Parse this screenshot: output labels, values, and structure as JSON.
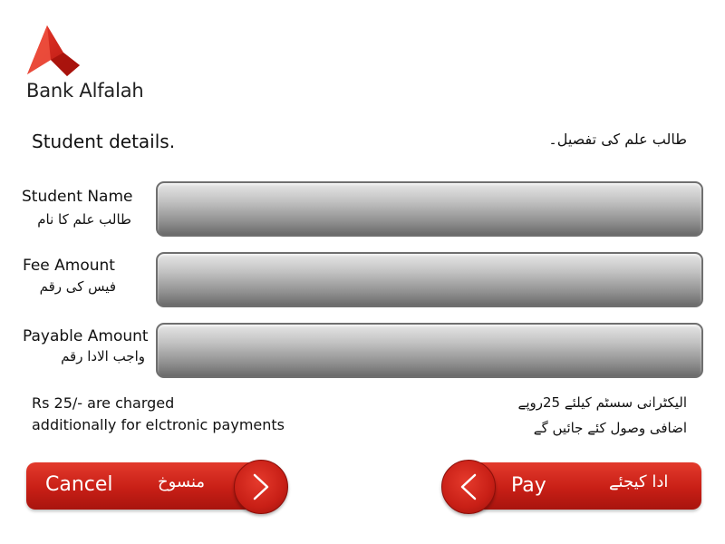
{
  "brand": {
    "name": "Bank Alfalah",
    "color": "#d3261b"
  },
  "heading": {
    "english": "Student details.",
    "urdu": "طالب علم کی تفصیل۔"
  },
  "fields": [
    {
      "label_en": "Student Name",
      "label_ur": "طالب علم کا نام",
      "value": ""
    },
    {
      "label_en": "Fee Amount",
      "label_ur": "فیس کی رقم",
      "value": ""
    },
    {
      "label_en": "Payable Amount",
      "label_ur": "واجب الادا رقم",
      "value": ""
    }
  ],
  "notes": {
    "english_line1": "Rs 25/- are charged",
    "english_line2": "additionally for elctronic payments",
    "urdu_line1": "الیکٹرانی سسٹم کیلئے 25روپے",
    "urdu_line2": "اضافی وصول کئے جائیں گے"
  },
  "buttons": {
    "cancel_en": "Cancel",
    "cancel_ur": "منسوخ",
    "pay_en": "Pay",
    "pay_ur": "ادا کیجئے"
  },
  "icons": {
    "cancel_arrow": "chevron-right-icon",
    "pay_arrow": "chevron-left-icon",
    "logo": "bank-alfalah-logo"
  }
}
